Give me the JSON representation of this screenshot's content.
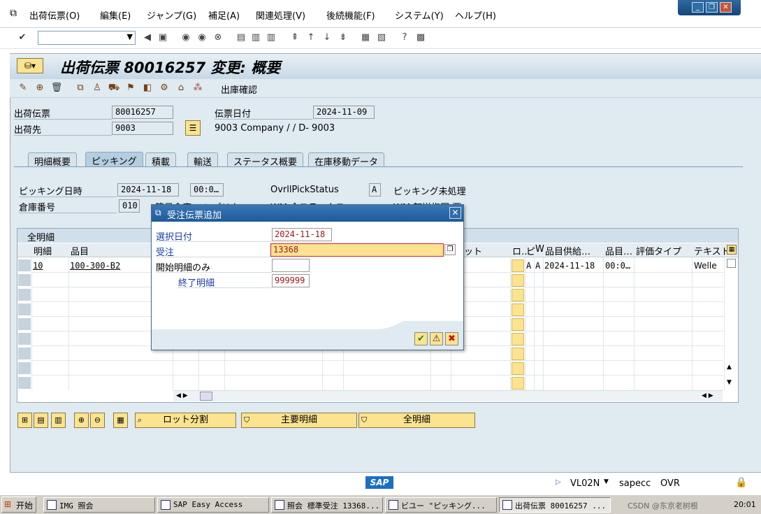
{
  "menu": [
    "出荷伝票(O)",
    "編集(E)",
    "ジャンプ(G)",
    "補足(A)",
    "関連処理(V)",
    "後続機能(F)",
    "システム(Y)",
    "ヘルプ(H)"
  ],
  "title": "出荷伝票 80016257 変更: 概要",
  "app_toolbar_text": "出庫確認",
  "header": {
    "delivery_label": "出荷伝票",
    "delivery_value": "80016257",
    "doc_date_label": "伝票日付",
    "doc_date_value": "2024-11-09",
    "shipto_label": "出荷先",
    "shipto_value": "9003",
    "shipto_text": "9003 Company / / D- 9003"
  },
  "tabs": [
    "明細概要",
    "ピッキング",
    "積載",
    "輸送",
    "ステータス概要",
    "在庫移動データ"
  ],
  "picking": {
    "pick_date_label": "ピッキング日時",
    "pick_date_value": "2024-11-18",
    "pick_time_value": "00:0…",
    "ovrl_label": "OvrllPickStatus",
    "ovrl_value": "A",
    "ovrl_text": "ピッキング未処理",
    "whs_label": "倉庫番号",
    "whs_value": "010",
    "partial_label_1": "簡易倉庫 ハンブリク",
    "partial_label_2": "WM 全ステータス",
    "partial_label_3": "WM 転送指図 要"
  },
  "table": {
    "title": "全明細",
    "columns": [
      "明細",
      "品目",
      "ット",
      "ロ…",
      "ピ",
      "W",
      "品目供給…",
      "品目…",
      "評価タイプ",
      "テキスト"
    ],
    "row": {
      "item": "10",
      "material": "100-300-B2",
      "c1": "A",
      "c2": "A",
      "date": "2024-11-18",
      "time": "00:0…",
      "text": "Welle"
    }
  },
  "bottom_buttons": [
    "ロット分割",
    "主要明細",
    "全明細"
  ],
  "status": {
    "tcode": "VL02N",
    "server": "sapecc",
    "mode": "OVR"
  },
  "taskbar": {
    "start": "开始",
    "tasks": [
      "IMG 照会",
      "SAP Easy Access",
      "照会 標準受注 13368...",
      "ビユー \"ピッキング...",
      "出荷伝票 80016257 ..."
    ],
    "tray_text": "CSDN @东京老树根",
    "clock": "20:01"
  },
  "dialog": {
    "title": "受注伝票追加",
    "sel_date_label": "選択日付",
    "sel_date_value": "2024-11-18",
    "order_label": "受注",
    "order_value": "13368",
    "start_item_label": "開始明細のみ",
    "start_item_value": "",
    "end_item_label": "終了明細",
    "end_item_value": "999999"
  }
}
